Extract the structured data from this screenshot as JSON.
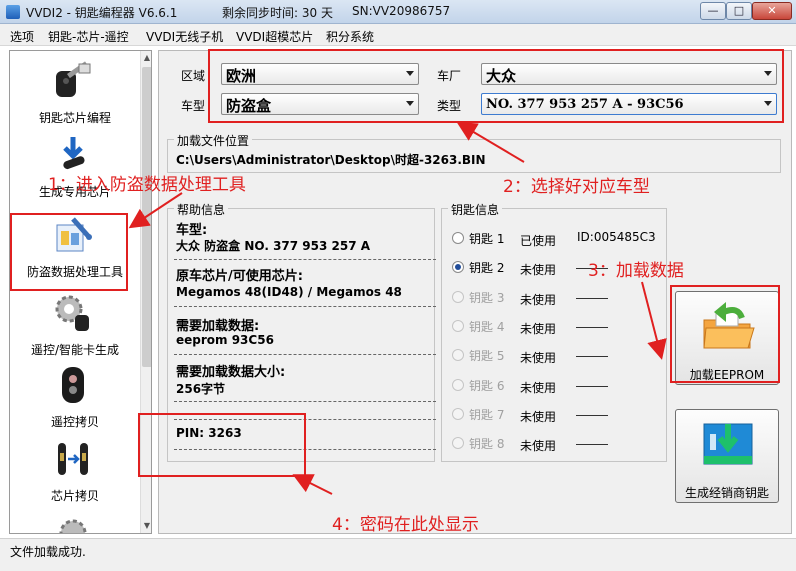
{
  "window": {
    "title": "VVDI2 - 钥匙编程器 V6.6.1",
    "remaining": "剩余同步时间: 30 天",
    "sn": "SN:VV20986757",
    "minimize": "—",
    "maximize": "□",
    "close": "✕"
  },
  "menu": [
    "选项",
    "钥匙-芯片-遥控",
    "VVDI无线子机",
    "VVDI超模芯片",
    "积分系统"
  ],
  "sidebar": {
    "items": [
      {
        "label": "钥匙芯片编程",
        "icon": "car-key-icon"
      },
      {
        "label": "生成专用芯片",
        "icon": "transponder-chip-icon"
      },
      {
        "label": "防盗数据处理工具",
        "icon": "immo-tool-icon"
      },
      {
        "label": "遥控/智能卡生成",
        "icon": "remote-gear-icon"
      },
      {
        "label": "遥控拷贝",
        "icon": "remote-copy-icon"
      },
      {
        "label": "芯片拷贝",
        "icon": "chip-copy-icon"
      }
    ]
  },
  "selection": {
    "region_label": "区域",
    "region_value": "欧洲",
    "maker_label": "车厂",
    "maker_value": "大众",
    "model_label": "车型",
    "model_value": "防盗盒",
    "type_label": "类型",
    "type_value": "NO. 377 953 257 A - 93C56"
  },
  "file": {
    "label": "加载文件位置",
    "path": "C:\\Users\\Administrator\\Desktop\\时超-3263.BIN"
  },
  "help": {
    "title": "帮助信息",
    "model_head": "车型:",
    "model_value": "大众 防盗盒 NO. 377 953 257 A",
    "chip_head": "原车芯片/可使用芯片:",
    "chip_value": "Megamos 48(ID48) / Megamos 48",
    "data_head": "需要加载数据:",
    "data_value": "eeprom 93C56",
    "size_head": "需要加载数据大小:",
    "size_value": "256字节",
    "pin": "PIN: 3263"
  },
  "keys": {
    "title": "钥匙信息",
    "items": [
      {
        "name": "钥匙 1",
        "status": "已使用",
        "id": "ID:005485C3",
        "checked": false,
        "enabled": true
      },
      {
        "name": "钥匙 2",
        "status": "未使用",
        "id": "",
        "checked": true,
        "enabled": true
      },
      {
        "name": "钥匙 3",
        "status": "未使用",
        "id": "",
        "checked": false,
        "enabled": false
      },
      {
        "name": "钥匙 4",
        "status": "未使用",
        "id": "",
        "checked": false,
        "enabled": false
      },
      {
        "name": "钥匙 5",
        "status": "未使用",
        "id": "",
        "checked": false,
        "enabled": false
      },
      {
        "name": "钥匙 6",
        "status": "未使用",
        "id": "",
        "checked": false,
        "enabled": false
      },
      {
        "name": "钥匙 7",
        "status": "未使用",
        "id": "",
        "checked": false,
        "enabled": false
      },
      {
        "name": "钥匙 8",
        "status": "未使用",
        "id": "",
        "checked": false,
        "enabled": false
      }
    ]
  },
  "buttons": {
    "load_eeprom": "加载EEPROM",
    "dealer_key": "生成经销商钥匙"
  },
  "status": "文件加载成功.",
  "annotations": {
    "step1": "1：进入防盗数据处理工具",
    "step2": "2：选择好对应车型",
    "step3": "3：加载数据",
    "step4": "4：密码在此处显示"
  },
  "colors": {
    "annotation": "#e02020",
    "selection_accent": "#3d7bd0"
  }
}
